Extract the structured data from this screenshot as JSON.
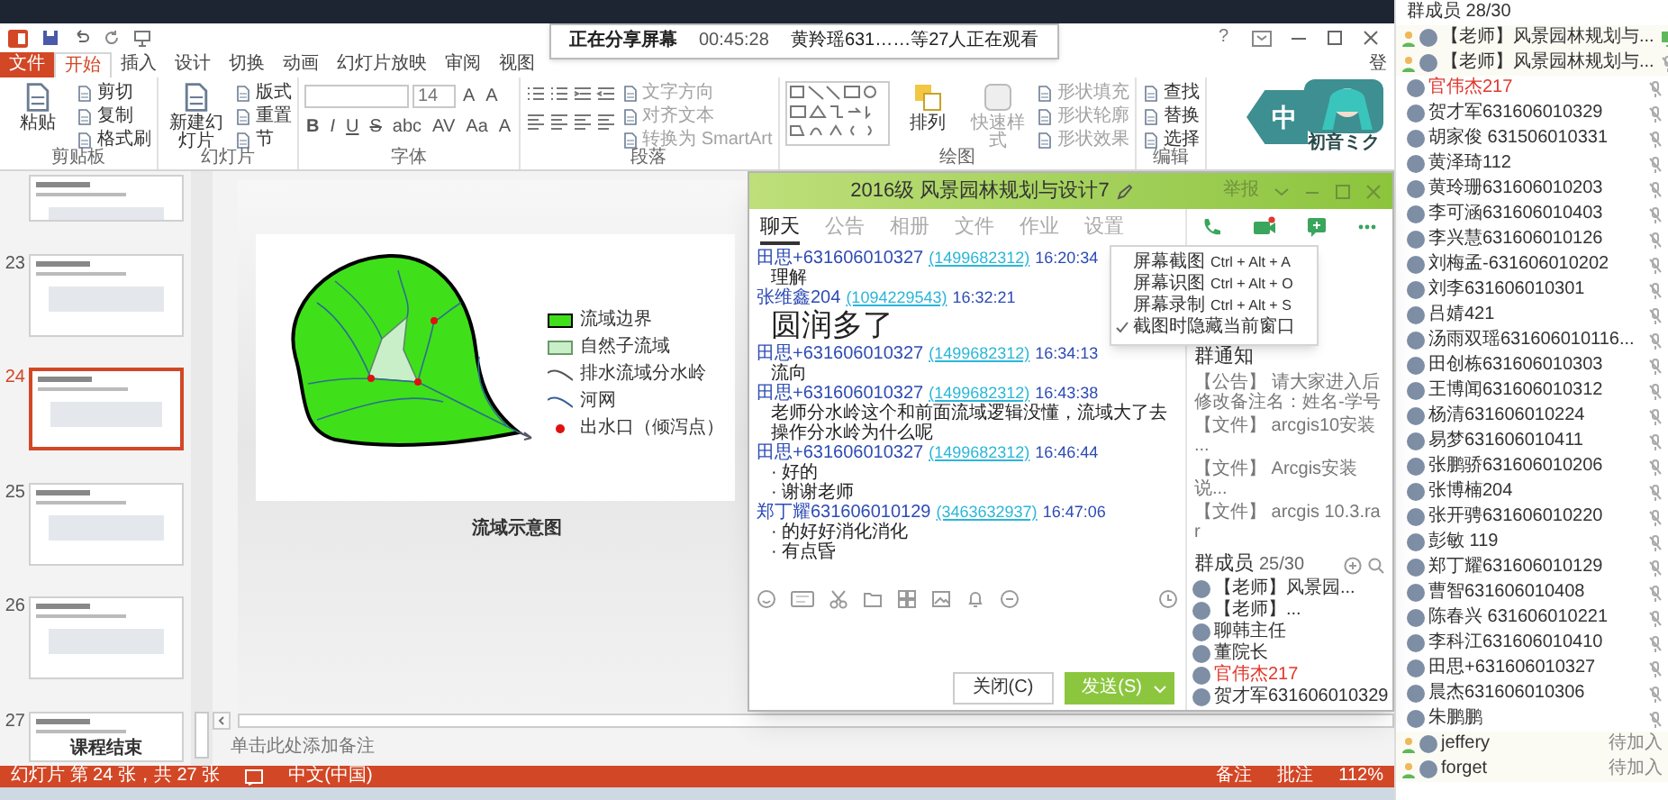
{
  "share_bar": {
    "status": "正在分享屏幕",
    "elapsed": "00:45:28",
    "viewers": "黄羚瑶631……等27人正在观看"
  },
  "ppt": {
    "help": "?",
    "tabs": [
      {
        "label": "文件",
        "kind": "file",
        "selected": false
      },
      {
        "label": "开始",
        "kind": "tab",
        "selected": true
      },
      {
        "label": "插入",
        "kind": "tab",
        "selected": false
      },
      {
        "label": "设计",
        "kind": "tab",
        "selected": false
      },
      {
        "label": "切换",
        "kind": "tab",
        "selected": false
      },
      {
        "label": "动画",
        "kind": "tab",
        "selected": false
      },
      {
        "label": "幻灯片放映",
        "kind": "tab",
        "selected": false
      },
      {
        "label": "审阅",
        "kind": "tab",
        "selected": false
      },
      {
        "label": "视图",
        "kind": "tab",
        "selected": false
      }
    ],
    "sign_in": "登",
    "ribbon": [
      {
        "title": "剪贴板",
        "kind": "basic",
        "large": [
          {
            "label": "粘贴",
            "disabled": false
          }
        ],
        "small": [
          {
            "label": "剪切",
            "disabled": false
          },
          {
            "label": "复制",
            "disabled": false
          },
          {
            "label": "格式刷",
            "disabled": false
          }
        ]
      },
      {
        "title": "幻灯片",
        "kind": "basic",
        "large": [
          {
            "label": "新建幻灯片",
            "disabled": false
          }
        ],
        "small": [
          {
            "label": "版式",
            "disabled": false
          },
          {
            "label": "重置",
            "disabled": false
          },
          {
            "label": "节",
            "disabled": false
          }
        ]
      },
      {
        "title": "字体",
        "kind": "font",
        "font_size": "14",
        "size_buttons": [
          "A",
          "A"
        ],
        "format_buttons": [
          "B",
          "I",
          "U",
          "S",
          "abc",
          "AV",
          "Aa",
          "A"
        ]
      },
      {
        "title": "段落",
        "kind": "paragraph",
        "small": [
          {
            "label": "文字方向",
            "disabled": true
          },
          {
            "label": "对齐文本",
            "disabled": true
          },
          {
            "label": "转换为 SmartArt",
            "disabled": true
          }
        ]
      },
      {
        "title": "绘图",
        "kind": "drawing",
        "large": [
          {
            "label": "排列",
            "disabled": false
          },
          {
            "label": "快速样式",
            "disabled": true
          }
        ],
        "small": [
          {
            "label": "形状填充",
            "disabled": true
          },
          {
            "label": "形状轮廓",
            "disabled": true
          },
          {
            "label": "形状效果",
            "disabled": true
          }
        ]
      },
      {
        "title": "编辑",
        "kind": "basic",
        "small": [
          {
            "label": "查找",
            "disabled": false
          },
          {
            "label": "替换",
            "disabled": false
          },
          {
            "label": "选择",
            "disabled": false
          }
        ]
      }
    ],
    "ime_badge": {
      "mode": "中",
      "caption": "初音ミク"
    },
    "thumbnails": [
      {
        "selected": false
      },
      {
        "number": "23",
        "selected": false
      },
      {
        "number": "24",
        "selected": true
      },
      {
        "number": "25",
        "selected": false
      },
      {
        "number": "26",
        "selected": false
      },
      {
        "number": "27",
        "selected": false,
        "title": "课程结束"
      }
    ],
    "slide": {
      "legend": [
        {
          "label": "流域边界",
          "kind": "boundary"
        },
        {
          "label": "自然子流域",
          "kind": "subbasin"
        },
        {
          "label": "排水流域分水岭",
          "kind": "divide"
        },
        {
          "label": "河网",
          "kind": "stream"
        },
        {
          "label": "出水口（倾泻点）",
          "kind": "outlet"
        }
      ],
      "caption": "流域示意图"
    },
    "notes_placeholder": "单击此处添加备注",
    "status_bar": {
      "slide_info": "幻灯片 第 24 张，共 27 张",
      "language": "中文(中国)",
      "notes": "备注",
      "comments": "批注",
      "zoom": "112%"
    }
  },
  "chat": {
    "title": "2016级 风景园林规划与设计7",
    "report": "举报",
    "tabs": [
      {
        "label": "聊天",
        "selected": true
      },
      {
        "label": "公告",
        "selected": false
      },
      {
        "label": "相册",
        "selected": false
      },
      {
        "label": "文件",
        "selected": false
      },
      {
        "label": "作业",
        "selected": false
      },
      {
        "label": "设置",
        "selected": false
      }
    ],
    "menu": [
      {
        "label": "屏幕截图",
        "shortcut": "Ctrl + Alt + A",
        "checked": false
      },
      {
        "label": "屏幕识图",
        "shortcut": "Ctrl + Alt + O",
        "checked": false
      },
      {
        "label": "屏幕录制",
        "shortcut": "Ctrl + Alt + S",
        "checked": false
      },
      {
        "label": "截图时隐藏当前窗口",
        "checked": true
      }
    ],
    "messages": [
      {
        "sender": "田思+631606010327",
        "qq": "(1499682312)",
        "time": "16:20:34",
        "kind": "normal",
        "lines": [
          "理解"
        ]
      },
      {
        "sender": "张维鑫204",
        "qq": "(1094229543)",
        "time": "16:32:21",
        "kind": "large",
        "lines": [
          "圆润多了"
        ]
      },
      {
        "sender": "田思+631606010327",
        "qq": "(1499682312)",
        "time": "16:34:13",
        "kind": "normal",
        "lines": [
          "流向"
        ]
      },
      {
        "sender": "田思+631606010327",
        "qq": "(1499682312)",
        "time": "16:43:38",
        "kind": "normal",
        "lines": [
          "老师分水岭这个和前面流域逻辑没懂，流域大了去操作分水岭为什么呢"
        ]
      },
      {
        "sender": "田思+631606010327",
        "qq": "(1499682312)",
        "time": "16:46:44",
        "kind": "normal",
        "lines": [
          "· 好的",
          "· 谢谢老师"
        ]
      },
      {
        "sender": "郑丁耀631606010129",
        "qq": "(3463632937)",
        "time": "16:47:06",
        "kind": "normal",
        "lines": [
          "· 的好好消化消化",
          "· 有点昏"
        ]
      }
    ],
    "close_button": "关闭(C)",
    "send_button": "发送(S)",
    "notice": {
      "title": "群通知",
      "items": [
        "【公告】 请大家进入后修改备注名：姓名-学号",
        "【文件】 arcgis10安装 ...",
        "【文件】 Arcgis安装说...",
        "【文件】 arcgis 10.3.rar"
      ]
    },
    "members": {
      "title": "群成员",
      "count": "25/30",
      "items": [
        {
          "name": "【老师】风景园...",
          "highlighted": false
        },
        {
          "name": "【老师】...",
          "highlighted": false
        },
        {
          "name": "聊韩主任",
          "highlighted": false
        },
        {
          "name": "董院长",
          "highlighted": false
        },
        {
          "name": "官伟杰217",
          "highlighted": true
        },
        {
          "name": "贺才军631606010329",
          "highlighted": false
        }
      ]
    }
  },
  "member_panel": {
    "title": "群成员 28/30",
    "members": [
      {
        "name": "【老师】风景园林规划与...",
        "highlighted": false,
        "badge": true,
        "kind": "sharing"
      },
      {
        "name": "【老师】风景园林规划与...",
        "highlighted": false,
        "badge": true,
        "kind": "muted"
      },
      {
        "name": "官伟杰217",
        "highlighted": true,
        "badge": false,
        "kind": "muted"
      },
      {
        "name": "贺才军631606010329",
        "highlighted": false,
        "badge": false,
        "kind": "muted"
      },
      {
        "name": "胡家俊 631506010331",
        "highlighted": false,
        "badge": false,
        "kind": "muted"
      },
      {
        "name": "黄泽琦112",
        "highlighted": false,
        "badge": false,
        "kind": "muted"
      },
      {
        "name": "黄玲珊631606010203",
        "highlighted": false,
        "badge": false,
        "kind": "muted"
      },
      {
        "name": "李可涵631606010403",
        "highlighted": false,
        "badge": false,
        "kind": "muted"
      },
      {
        "name": "李兴慧631606010126",
        "highlighted": false,
        "badge": false,
        "kind": "muted"
      },
      {
        "name": "刘梅孟-631606010202",
        "highlighted": false,
        "badge": false,
        "kind": "muted"
      },
      {
        "name": "刘李631606010301",
        "highlighted": false,
        "badge": false,
        "kind": "muted"
      },
      {
        "name": "吕婧421",
        "highlighted": false,
        "badge": false,
        "kind": "muted"
      },
      {
        "name": "汤雨双瑶631606010116...",
        "highlighted": false,
        "badge": false,
        "kind": "muted"
      },
      {
        "name": "田创栋631606010303",
        "highlighted": false,
        "badge": false,
        "kind": "muted"
      },
      {
        "name": "王博闻631606010312",
        "highlighted": false,
        "badge": false,
        "kind": "muted"
      },
      {
        "name": "杨清631606010224",
        "highlighted": false,
        "badge": false,
        "kind": "muted"
      },
      {
        "name": "易梦631606010411",
        "highlighted": false,
        "badge": false,
        "kind": "muted"
      },
      {
        "name": "张鹏骄631606010206",
        "highlighted": false,
        "badge": false,
        "kind": "muted"
      },
      {
        "name": "张博楠204",
        "highlighted": false,
        "badge": false,
        "kind": "muted"
      },
      {
        "name": "张开骋631606010220",
        "highlighted": false,
        "badge": false,
        "kind": "muted"
      },
      {
        "name": "彭敏 119",
        "highlighted": false,
        "badge": false,
        "kind": "muted"
      },
      {
        "name": "郑丁耀631606010129",
        "highlighted": false,
        "badge": false,
        "kind": "muted"
      },
      {
        "name": "曹智631606010408",
        "highlighted": false,
        "badge": false,
        "kind": "muted"
      },
      {
        "name": "陈春兴 631606010221",
        "highlighted": false,
        "badge": false,
        "kind": "muted"
      },
      {
        "name": "李科江631606010410",
        "highlighted": false,
        "badge": false,
        "kind": "muted"
      },
      {
        "name": "田思+631606010327",
        "highlighted": false,
        "badge": false,
        "kind": "muted"
      },
      {
        "name": "晨杰631606010306",
        "highlighted": false,
        "badge": false,
        "kind": "muted"
      },
      {
        "name": "朱鹏鹏",
        "highlighted": false,
        "badge": false,
        "kind": "muted"
      },
      {
        "name": "jeffery",
        "highlighted": false,
        "badge": true,
        "kind": "pending",
        "status": "待加入"
      },
      {
        "name": "forget",
        "highlighted": false,
        "badge": true,
        "kind": "pending",
        "status": "待加入"
      }
    ]
  }
}
